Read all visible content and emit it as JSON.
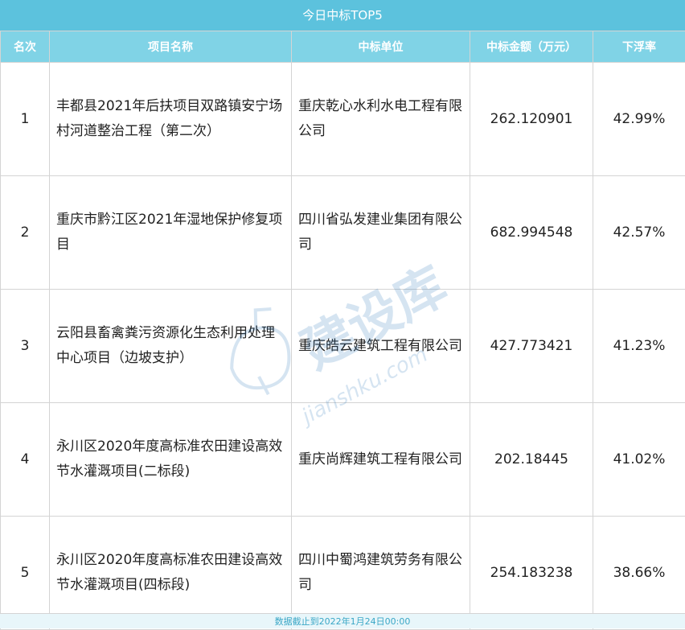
{
  "title": "今日中标TOP5",
  "headers": [
    "名次",
    "项目名称",
    "中标单位",
    "中标金额（万元）",
    "下浮率"
  ],
  "rows": [
    {
      "rank": "1",
      "project": "丰都县2021年后扶项目双路镇安宁场村河道整治工程（第二次）",
      "company": "重庆乾心水利水电工程有限公司",
      "amount": "262.120901",
      "rate": "42.99%"
    },
    {
      "rank": "2",
      "project": "重庆市黔江区2021年湿地保护修复项目",
      "company": "四川省弘发建业集团有限公司",
      "amount": "682.994548",
      "rate": "42.57%"
    },
    {
      "rank": "3",
      "project": "云阳县畜禽粪污资源化生态利用处理中心项目（边坡支护）",
      "company": "重庆皓云建筑工程有限公司",
      "amount": "427.773421",
      "rate": "41.23%"
    },
    {
      "rank": "4",
      "project": "永川区2020年度高标准农田建设高效节水灌溉项目(二标段)",
      "company": "重庆尚辉建筑工程有限公司",
      "amount": "202.18445",
      "rate": "41.02%"
    },
    {
      "rank": "5",
      "project": "永川区2020年度高标准农田建设高效节水灌溉项目(四标段)",
      "company": "四川中蜀鸿建筑劳务有限公司",
      "amount": "254.183238",
      "rate": "38.66%"
    }
  ],
  "footer": "数据截止到2022年1月24日00:00",
  "watermark": {
    "brand": "建设库",
    "url": "jianshku.com"
  },
  "colors": {
    "title_bg": "#5cc2dd",
    "header_bg": "#80d3e6",
    "footer_text": "#3aa7c6",
    "border": "#d4d4d4"
  }
}
